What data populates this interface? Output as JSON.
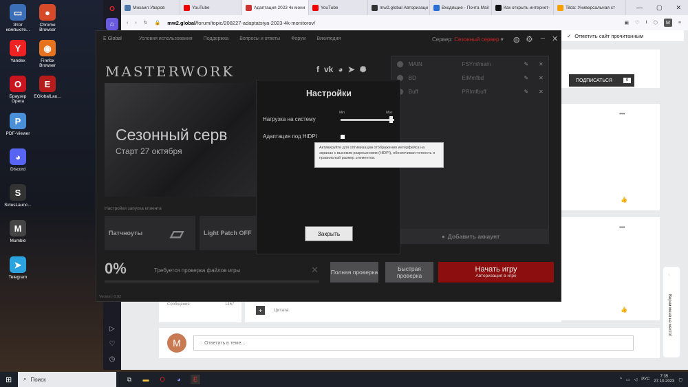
{
  "desktop": {
    "icons": [
      {
        "label": "Этот компьюте...",
        "color": "#3b6fb8",
        "glyph": "▭"
      },
      {
        "label": "Chrome Browser",
        "color": "#d64a2a",
        "glyph": "●"
      },
      {
        "label": "Yandex",
        "color": "#e22",
        "glyph": "Y"
      },
      {
        "label": "Firefox Browser",
        "color": "#e8731e",
        "glyph": "◉"
      },
      {
        "label": "Браузер Opera",
        "color": "#c9151f",
        "glyph": "O"
      },
      {
        "label": "EGlobalLau...",
        "color": "#b71c1c",
        "glyph": "E"
      },
      {
        "label": "PDF-Viewer",
        "color": "#4a90d9",
        "glyph": "P"
      },
      {
        "label": "Discord",
        "color": "#5865f2",
        "glyph": "◕"
      },
      {
        "label": "SiriusLaunc...",
        "color": "#333",
        "glyph": "S"
      },
      {
        "label": "Mumble",
        "color": "#444",
        "glyph": "M"
      },
      {
        "label": "Telegram",
        "color": "#2aa3de",
        "glyph": "➤"
      }
    ]
  },
  "browser": {
    "tabs": [
      {
        "title": "Михаил Уваров",
        "color": "#4a76a8"
      },
      {
        "title": "YouTube",
        "color": "#e00"
      },
      {
        "title": "Адаптация 2023 4к мони",
        "color": "#c33"
      },
      {
        "title": "YouTube",
        "color": "#e00"
      },
      {
        "title": "mw2.global Авторизаци",
        "color": "#333"
      },
      {
        "title": "Входящие - Почта Mail",
        "color": "#2c6fd4"
      },
      {
        "title": "Как открыть интернет-",
        "color": "#111"
      },
      {
        "title": "Tilda: Универсальная ст",
        "color": "#f4a000"
      }
    ],
    "url_host": "mw2.global",
    "url_path": "/forum/topic/208227-adaptatsiya-2023-4k-monitorov/",
    "avatar": "M",
    "mark_read": "Отметить сайт прочитанным"
  },
  "forum": {
    "subscribe": "ПОДПИСАТЬСЯ",
    "subscribe_count": "0",
    "posts_label": "Сообщения",
    "posts_value": "1467",
    "quote": "Цитата",
    "reply_placeholder": "Ответить в теме...",
    "reply_avatar": "M",
    "side_feedback": "Верни меня на место!",
    "more": "•••",
    "like": "👍"
  },
  "launcher": {
    "brand": "E Global",
    "nav": [
      "Условия использования",
      "Поддержка",
      "Вопросы и ответы",
      "Форум",
      "Википедия"
    ],
    "server_label": "Сервер:",
    "server_value": "Сезонный сервер",
    "logo": "MASTERWORK",
    "banner_title": "Сезонный серв",
    "banner_sub": "Старт 27 октября",
    "accounts": [
      {
        "name": "MAIN",
        "char": "FSYmfmain"
      },
      {
        "name": "BD",
        "char": "ElMmfbd"
      },
      {
        "name": "Buff",
        "char": "PRImfbuff"
      }
    ],
    "add_account": "Добавить аккаунт",
    "launch_settings": "Настройки запуска клиента",
    "tiles": [
      "Патчноуты",
      "Light Patch OFF"
    ],
    "percent": "0%",
    "status": "Требуется проверка файлов игры",
    "progress": 0,
    "full_check": "Полная проверка",
    "quick_check": "Быстрая проверка",
    "start_game": "Начать игру",
    "start_sub": "Авторизация в игре",
    "version": "Version: 0.92"
  },
  "settings_modal": {
    "title": "Настройки",
    "load_label": "Нагрузка на систему",
    "slider_min": "Min",
    "slider_max": "Max",
    "slider_value": 0.95,
    "hidpi_label": "Адаптация под HiDPI",
    "hidpi_checked": false,
    "tooltip": "Активируйте для оптимизации отображения интерфейса на экранах с высоким разрешением (HiDPI), обеспечивая четкость и правильный размер элементов.",
    "close": "Закрыть"
  },
  "taskbar": {
    "search": "Поиск",
    "lang": "РУС",
    "time": "7:35",
    "date": "27.10.2023"
  }
}
